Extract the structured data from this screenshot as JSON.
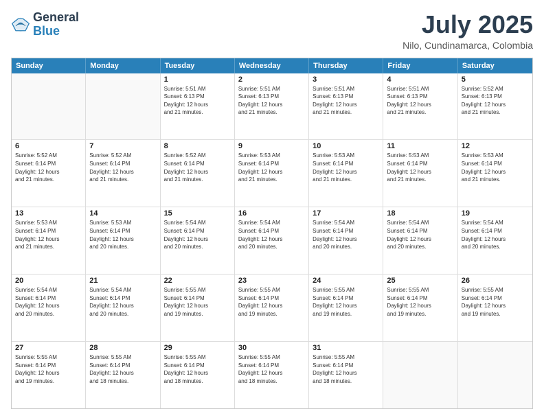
{
  "logo": {
    "line1": "General",
    "line2": "Blue"
  },
  "title": "July 2025",
  "subtitle": "Nilo, Cundinamarca, Colombia",
  "weekdays": [
    "Sunday",
    "Monday",
    "Tuesday",
    "Wednesday",
    "Thursday",
    "Friday",
    "Saturday"
  ],
  "weeks": [
    [
      {
        "day": "",
        "info": ""
      },
      {
        "day": "",
        "info": ""
      },
      {
        "day": "1",
        "info": "Sunrise: 5:51 AM\nSunset: 6:13 PM\nDaylight: 12 hours\nand 21 minutes."
      },
      {
        "day": "2",
        "info": "Sunrise: 5:51 AM\nSunset: 6:13 PM\nDaylight: 12 hours\nand 21 minutes."
      },
      {
        "day": "3",
        "info": "Sunrise: 5:51 AM\nSunset: 6:13 PM\nDaylight: 12 hours\nand 21 minutes."
      },
      {
        "day": "4",
        "info": "Sunrise: 5:51 AM\nSunset: 6:13 PM\nDaylight: 12 hours\nand 21 minutes."
      },
      {
        "day": "5",
        "info": "Sunrise: 5:52 AM\nSunset: 6:13 PM\nDaylight: 12 hours\nand 21 minutes."
      }
    ],
    [
      {
        "day": "6",
        "info": "Sunrise: 5:52 AM\nSunset: 6:14 PM\nDaylight: 12 hours\nand 21 minutes."
      },
      {
        "day": "7",
        "info": "Sunrise: 5:52 AM\nSunset: 6:14 PM\nDaylight: 12 hours\nand 21 minutes."
      },
      {
        "day": "8",
        "info": "Sunrise: 5:52 AM\nSunset: 6:14 PM\nDaylight: 12 hours\nand 21 minutes."
      },
      {
        "day": "9",
        "info": "Sunrise: 5:53 AM\nSunset: 6:14 PM\nDaylight: 12 hours\nand 21 minutes."
      },
      {
        "day": "10",
        "info": "Sunrise: 5:53 AM\nSunset: 6:14 PM\nDaylight: 12 hours\nand 21 minutes."
      },
      {
        "day": "11",
        "info": "Sunrise: 5:53 AM\nSunset: 6:14 PM\nDaylight: 12 hours\nand 21 minutes."
      },
      {
        "day": "12",
        "info": "Sunrise: 5:53 AM\nSunset: 6:14 PM\nDaylight: 12 hours\nand 21 minutes."
      }
    ],
    [
      {
        "day": "13",
        "info": "Sunrise: 5:53 AM\nSunset: 6:14 PM\nDaylight: 12 hours\nand 21 minutes."
      },
      {
        "day": "14",
        "info": "Sunrise: 5:53 AM\nSunset: 6:14 PM\nDaylight: 12 hours\nand 20 minutes."
      },
      {
        "day": "15",
        "info": "Sunrise: 5:54 AM\nSunset: 6:14 PM\nDaylight: 12 hours\nand 20 minutes."
      },
      {
        "day": "16",
        "info": "Sunrise: 5:54 AM\nSunset: 6:14 PM\nDaylight: 12 hours\nand 20 minutes."
      },
      {
        "day": "17",
        "info": "Sunrise: 5:54 AM\nSunset: 6:14 PM\nDaylight: 12 hours\nand 20 minutes."
      },
      {
        "day": "18",
        "info": "Sunrise: 5:54 AM\nSunset: 6:14 PM\nDaylight: 12 hours\nand 20 minutes."
      },
      {
        "day": "19",
        "info": "Sunrise: 5:54 AM\nSunset: 6:14 PM\nDaylight: 12 hours\nand 20 minutes."
      }
    ],
    [
      {
        "day": "20",
        "info": "Sunrise: 5:54 AM\nSunset: 6:14 PM\nDaylight: 12 hours\nand 20 minutes."
      },
      {
        "day": "21",
        "info": "Sunrise: 5:54 AM\nSunset: 6:14 PM\nDaylight: 12 hours\nand 20 minutes."
      },
      {
        "day": "22",
        "info": "Sunrise: 5:55 AM\nSunset: 6:14 PM\nDaylight: 12 hours\nand 19 minutes."
      },
      {
        "day": "23",
        "info": "Sunrise: 5:55 AM\nSunset: 6:14 PM\nDaylight: 12 hours\nand 19 minutes."
      },
      {
        "day": "24",
        "info": "Sunrise: 5:55 AM\nSunset: 6:14 PM\nDaylight: 12 hours\nand 19 minutes."
      },
      {
        "day": "25",
        "info": "Sunrise: 5:55 AM\nSunset: 6:14 PM\nDaylight: 12 hours\nand 19 minutes."
      },
      {
        "day": "26",
        "info": "Sunrise: 5:55 AM\nSunset: 6:14 PM\nDaylight: 12 hours\nand 19 minutes."
      }
    ],
    [
      {
        "day": "27",
        "info": "Sunrise: 5:55 AM\nSunset: 6:14 PM\nDaylight: 12 hours\nand 19 minutes."
      },
      {
        "day": "28",
        "info": "Sunrise: 5:55 AM\nSunset: 6:14 PM\nDaylight: 12 hours\nand 18 minutes."
      },
      {
        "day": "29",
        "info": "Sunrise: 5:55 AM\nSunset: 6:14 PM\nDaylight: 12 hours\nand 18 minutes."
      },
      {
        "day": "30",
        "info": "Sunrise: 5:55 AM\nSunset: 6:14 PM\nDaylight: 12 hours\nand 18 minutes."
      },
      {
        "day": "31",
        "info": "Sunrise: 5:55 AM\nSunset: 6:14 PM\nDaylight: 12 hours\nand 18 minutes."
      },
      {
        "day": "",
        "info": ""
      },
      {
        "day": "",
        "info": ""
      }
    ]
  ]
}
